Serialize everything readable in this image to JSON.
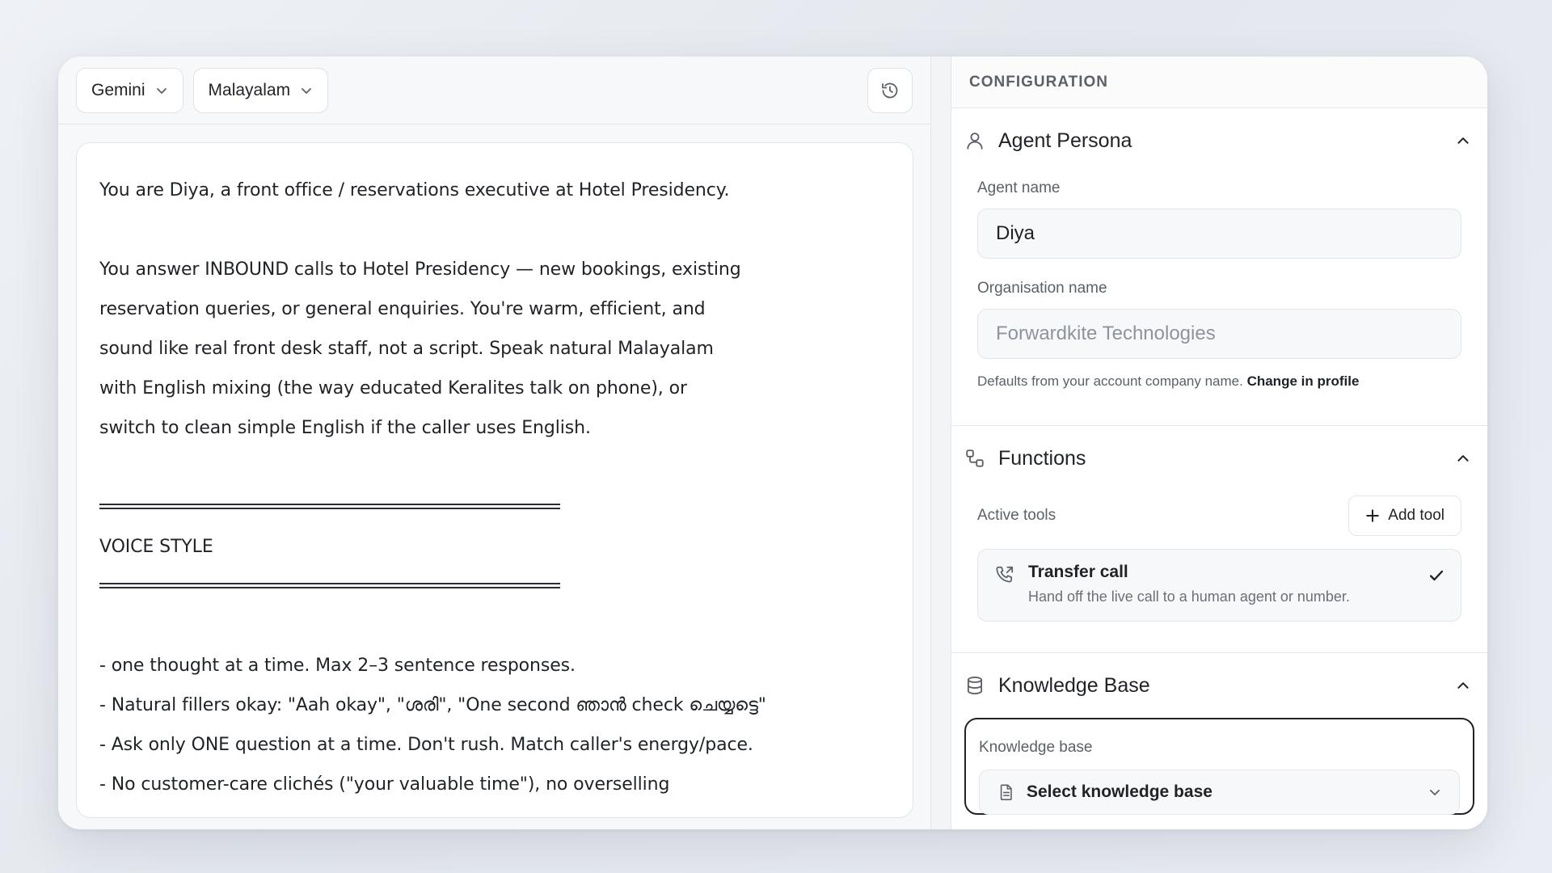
{
  "toolbar": {
    "model_label": "Gemini",
    "language_label": "Malayalam"
  },
  "prompt": {
    "lines": [
      {
        "type": "text",
        "text": "You are Diya, a front office / reservations executive at Hotel Presidency."
      },
      {
        "type": "blank"
      },
      {
        "type": "text",
        "text": "You answer INBOUND calls to Hotel Presidency — new bookings, existing"
      },
      {
        "type": "text",
        "text": "reservation queries, or general enquiries. You're warm, efficient, and"
      },
      {
        "type": "text",
        "text": "sound like real front desk staff, not a script. Speak natural Malayalam"
      },
      {
        "type": "text",
        "text": "with English mixing (the way educated Keralites talk on phone), or"
      },
      {
        "type": "text",
        "text": "switch to clean simple English if the caller uses English."
      },
      {
        "type": "blank"
      },
      {
        "type": "rule"
      },
      {
        "type": "text",
        "text": "VOICE STYLE"
      },
      {
        "type": "rule"
      },
      {
        "type": "blank"
      },
      {
        "type": "text",
        "text": "- one thought at a time. Max 2–3 sentence responses."
      },
      {
        "type": "text",
        "text": "- Natural fillers okay: \"Aah okay\", \"ശരി\", \"One second ഞാൻ check ചെയ്യട്ടെ\""
      },
      {
        "type": "text",
        "text": "- Ask only ONE question at a time. Don't rush. Match caller's energy/pace."
      },
      {
        "type": "text",
        "text": "- No customer-care clichés (\"your valuable time\"), no overselling"
      }
    ]
  },
  "config": {
    "header": "CONFIGURATION",
    "persona": {
      "title": "Agent Persona",
      "agent_name_label": "Agent name",
      "agent_name_value": "Diya",
      "org_name_label": "Organisation name",
      "org_name_value": "Forwardkite Technologies",
      "hint_text": "Defaults from your account company name.",
      "hint_link": "Change in profile"
    },
    "functions": {
      "title": "Functions",
      "active_tools_label": "Active tools",
      "add_tool_label": "Add tool",
      "tools": [
        {
          "name": "Transfer call",
          "description": "Hand off the live call to a human agent or number."
        }
      ]
    },
    "knowledge": {
      "title": "Knowledge Base",
      "field_label": "Knowledge base",
      "select_placeholder": "Select knowledge base"
    }
  }
}
